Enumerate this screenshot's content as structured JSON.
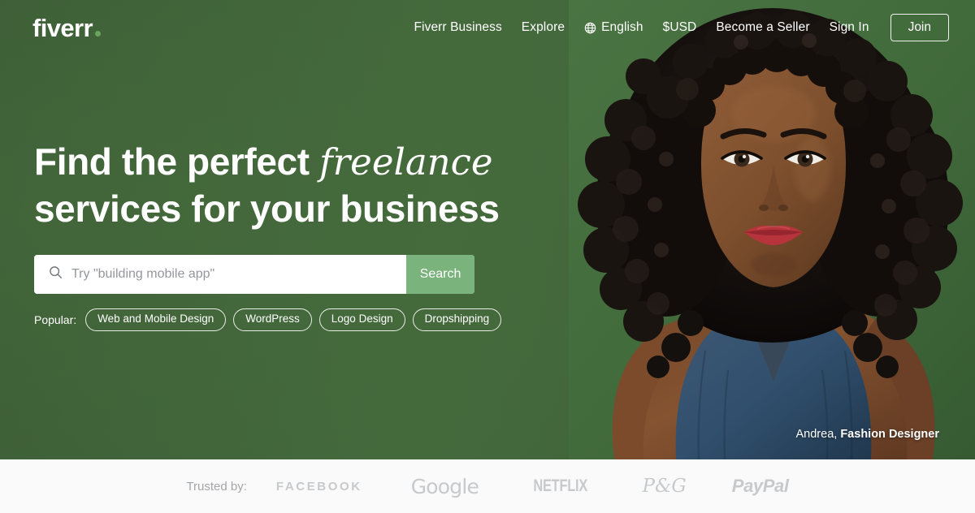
{
  "brand": {
    "logo_text": "fiverr",
    "logo_dot": "•",
    "accent_color": "#6aa45f",
    "hero_bg_color": "#41633a",
    "search_button_color": "#7ab37b"
  },
  "nav": {
    "items": [
      {
        "label": "Fiverr Business",
        "icon": ""
      },
      {
        "label": "Explore",
        "icon": ""
      },
      {
        "label": "English",
        "icon": "globe-icon"
      },
      {
        "label": "$USD",
        "icon": ""
      },
      {
        "label": "Become a Seller",
        "icon": ""
      },
      {
        "label": "Sign In",
        "icon": ""
      }
    ],
    "join_label": "Join"
  },
  "hero": {
    "headline_part1": "Find the perfect ",
    "headline_italic": "freelance",
    "headline_line2": "services for your business",
    "search": {
      "placeholder": "Try \"building mobile app\"",
      "value": "",
      "button_label": "Search",
      "icon": "search-icon"
    },
    "popular": {
      "label": "Popular:",
      "tags": [
        "Web and Mobile Design",
        "WordPress",
        "Logo Design",
        "Dropshipping"
      ]
    },
    "credit": {
      "name": "Andrea,",
      "role": "Fashion Designer"
    }
  },
  "trusted": {
    "label": "Trusted by:",
    "brands": [
      "FACEBOOK",
      "Google",
      "NETFLIX",
      "P&G",
      "PayPal"
    ]
  }
}
